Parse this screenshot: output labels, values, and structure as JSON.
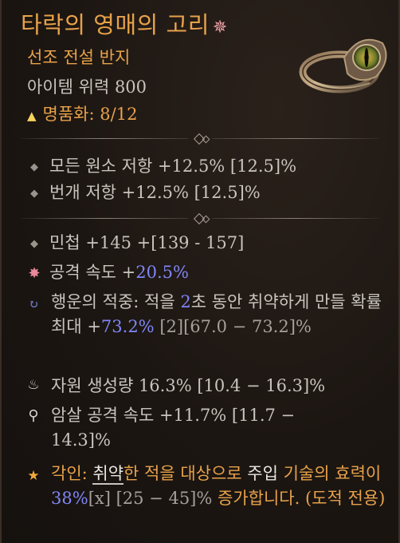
{
  "item": {
    "name": "타락의 영매의 고리",
    "type": "선조 전설 반지",
    "power": "아이템 위력 800",
    "masterwork_label": "명품화:",
    "masterwork_value": "8/12"
  },
  "colors": {
    "legendary": "#e8a24a",
    "stat": "#c8c4bd",
    "highlight": "#7f86f5",
    "bracket": "#a5a09a"
  },
  "implicits": [
    {
      "text": "모든 원소 저항 +12.5% [12.5]%"
    },
    {
      "text": "번개 저항 +12.5% [12.5]%"
    }
  ],
  "affixes": {
    "agility": "민첩 +145 +[139 - 157]",
    "attack_speed_label": "공격 속도 +",
    "attack_speed_value": "20.5%",
    "lucky_label": "행운의 적중: 적을 ",
    "lucky_sec": "2",
    "lucky_mid": "초 동안 취약하게 만들 확률 최대 +",
    "lucky_value": "73.2%",
    "lucky_tail": " [2][67.0 − 73.2]%",
    "resource": "자원 생성량 16.3% [10.4 − 16.3]%",
    "imbue_speed": "암살 공격 속도 +11.7% [11.7 − 14.3]%"
  },
  "aspect": {
    "prefix": "각인: ",
    "keyword": "취약",
    "part1": "한 적을 대상으로 ",
    "skill": "주입",
    "part2": " 기술의 효력이 ",
    "value": "38%",
    "value_bracket": "[x]",
    "range": " [25 − 45]%",
    "part3": " 증가합니다. (도적 전용)"
  },
  "icons": [
    "gem-icon",
    "triangle-icon",
    "diamond-bullet-icon",
    "burst-icon",
    "swirl-icon",
    "flame-icon",
    "dagger-icon",
    "star-icon",
    "ring-image"
  ]
}
